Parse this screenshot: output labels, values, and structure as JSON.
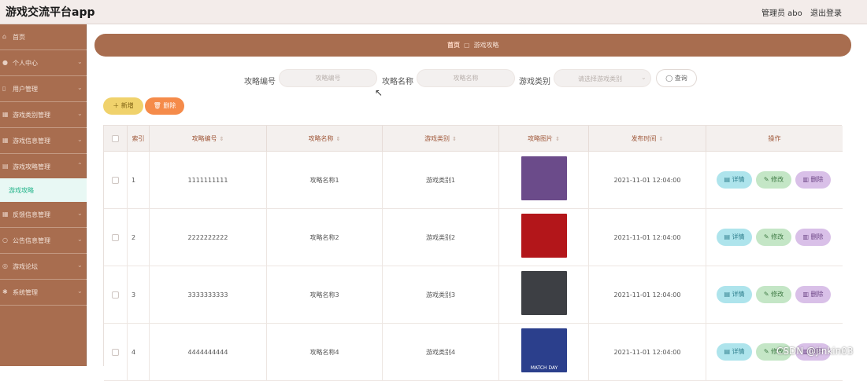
{
  "app_title": "游戏交流平台app",
  "header": {
    "admin": "管理员 abo",
    "logout": "退出登录"
  },
  "sidebar": {
    "items": [
      {
        "label": "首页",
        "icon": "home-icon"
      },
      {
        "label": "个人中心",
        "icon": "user-icon"
      },
      {
        "label": "用户管理",
        "icon": "users-icon"
      },
      {
        "label": "游戏类别管理",
        "icon": "grid-icon"
      },
      {
        "label": "游戏信息管理",
        "icon": "grid-icon"
      },
      {
        "label": "游戏攻略管理",
        "icon": "book-icon"
      },
      {
        "label": "反馈信息管理",
        "icon": "grid-icon"
      },
      {
        "label": "公告信息管理",
        "icon": "notice-icon"
      },
      {
        "label": "游戏论坛",
        "icon": "forum-icon"
      },
      {
        "label": "系统管理",
        "icon": "gear-icon"
      }
    ],
    "active_sub": "游戏攻略"
  },
  "breadcrumb": {
    "home": "首页",
    "current": "游戏攻略"
  },
  "filters": {
    "code_label": "攻略编号",
    "code_placeholder": "攻略编号",
    "name_label": "攻略名称",
    "name_placeholder": "攻略名称",
    "type_label": "游戏类别",
    "type_placeholder": "请选择游戏类别",
    "query": "查询"
  },
  "actions": {
    "add": "新增",
    "delete": "删除"
  },
  "table": {
    "headers": [
      "索引",
      "攻略编号",
      "攻略名称",
      "游戏类别",
      "攻略图片",
      "发布时间",
      "操作"
    ],
    "rows": [
      {
        "index": "1",
        "code": "1111111111",
        "name": "攻略名称1",
        "type": "游戏类别1",
        "time": "2021-11-01 12:04:00",
        "thumb_color": "#6b4b8a",
        "thumb_text": ""
      },
      {
        "index": "2",
        "code": "2222222222",
        "name": "攻略名称2",
        "type": "游戏类别2",
        "time": "2021-11-01 12:04:00",
        "thumb_color": "#b3161a",
        "thumb_text": ""
      },
      {
        "index": "3",
        "code": "3333333333",
        "name": "攻略名称3",
        "type": "游戏类别3",
        "time": "2021-11-01 12:04:00",
        "thumb_color": "#3d3f44",
        "thumb_text": ""
      },
      {
        "index": "4",
        "code": "4444444444",
        "name": "攻略名称4",
        "type": "游戏类别4",
        "time": "2021-11-01 12:04:00",
        "thumb_color": "#2b3f8c",
        "thumb_text": "MATCH DAY"
      }
    ],
    "row_buttons": {
      "detail": "详情",
      "edit": "修改",
      "delete": "删除"
    }
  },
  "watermark": "CSDN @jinkin03"
}
